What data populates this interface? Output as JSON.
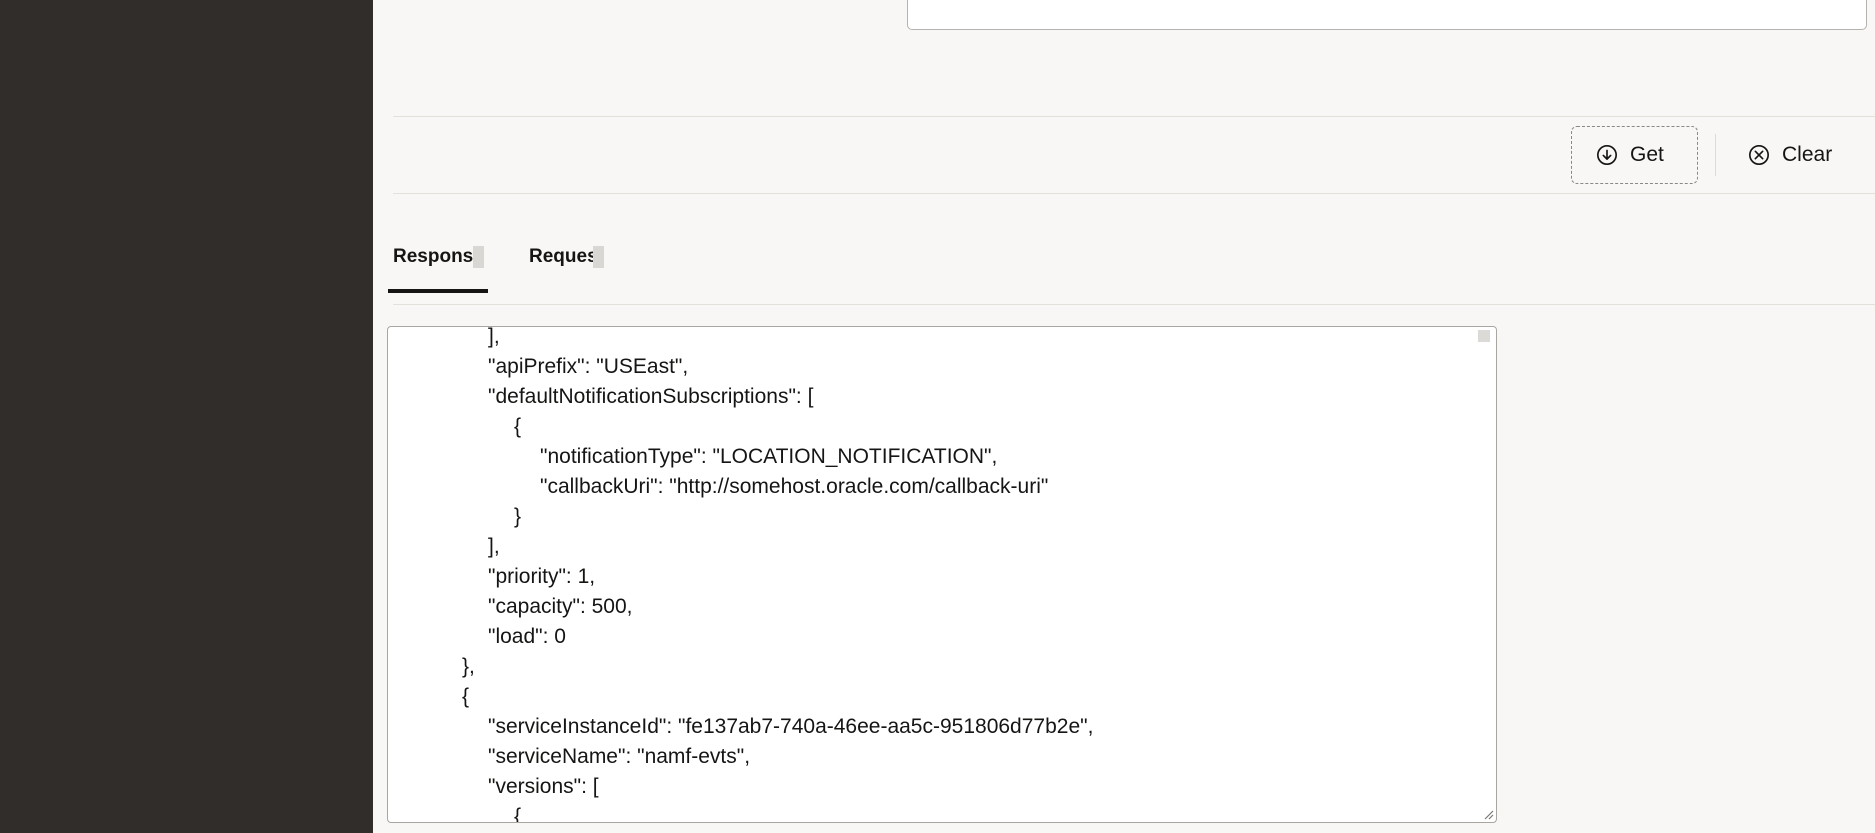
{
  "actions": {
    "get_label": "Get",
    "clear_label": "Clear"
  },
  "tabs": {
    "response_label": "Respons",
    "request_label": "Reques"
  },
  "response": {
    "lines": [
      "      ],",
      "      \"apiPrefix\": \"USEast\",",
      "      \"defaultNotificationSubscriptions\": [",
      "        {",
      "          \"notificationType\": \"LOCATION_NOTIFICATION\",",
      "          \"callbackUri\": \"http://somehost.oracle.com/callback-uri\"",
      "        }",
      "      ],",
      "      \"priority\": 1,",
      "      \"capacity\": 500,",
      "      \"load\": 0",
      "    },",
      "    {",
      "      \"serviceInstanceId\": \"fe137ab7-740a-46ee-aa5c-951806d77b2e\",",
      "      \"serviceName\": \"namf-evts\",",
      "      \"versions\": [",
      "        {"
    ]
  },
  "icons": {
    "get": "download-circle-icon",
    "clear": "close-circle-icon"
  }
}
